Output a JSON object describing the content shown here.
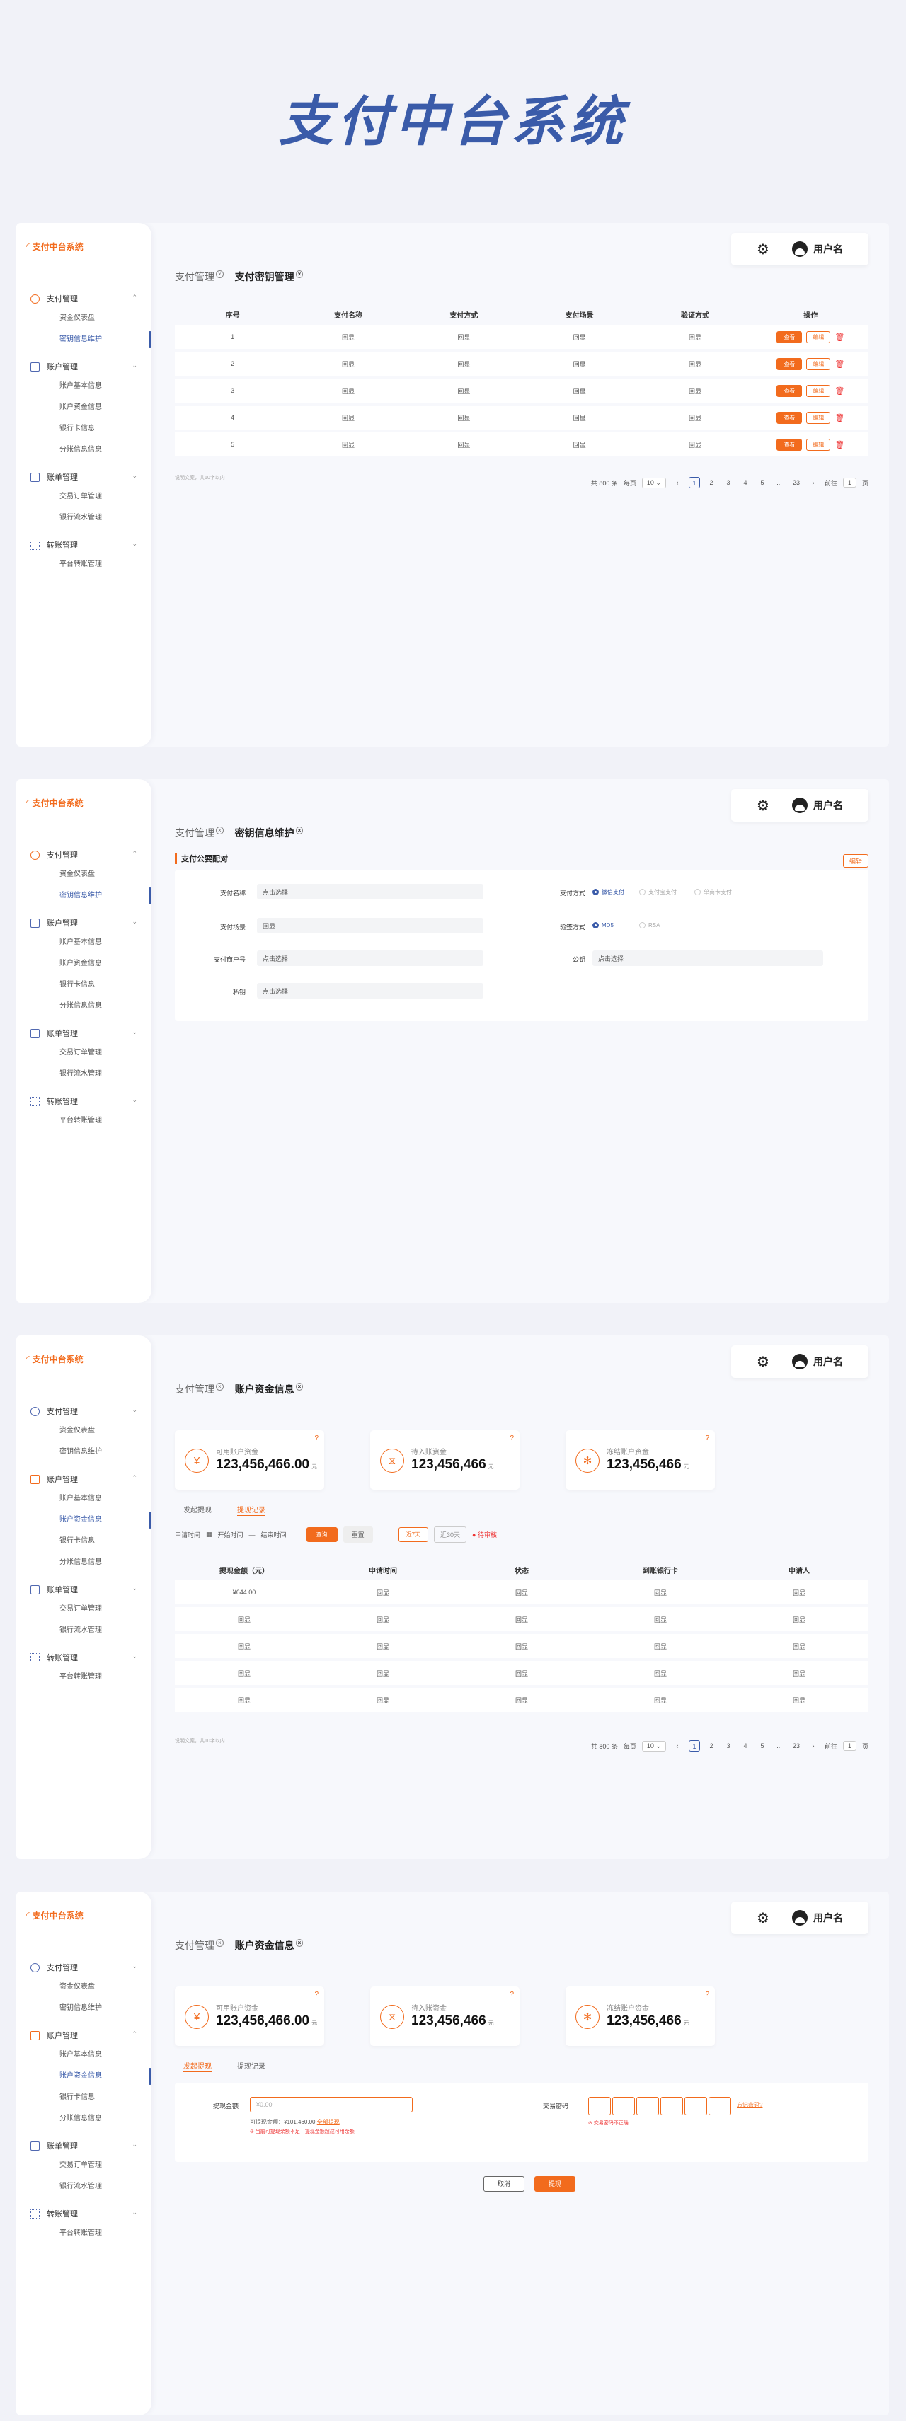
{
  "hero_title": "支付中台系统",
  "brand": "支付中台系统",
  "user_name": "用户名",
  "colors": {
    "accent": "#f26b1d",
    "primary": "#3a5ba9",
    "danger": "#e33333"
  },
  "menu": [
    {
      "label": "支付管理",
      "items": [
        "资金仪表盘",
        "密钥信息维护"
      ]
    },
    {
      "label": "账户管理",
      "items": [
        "账户基本信息",
        "账户资金信息",
        "银行卡信息",
        "分账信息信息"
      ]
    },
    {
      "label": "账单管理",
      "items": [
        "交易订单管理",
        "银行流水管理"
      ]
    },
    {
      "label": "转账管理",
      "items": [
        "平台转账管理"
      ]
    }
  ],
  "screen1": {
    "crumb1": "支付管理",
    "crumb2": "支付密钥管理",
    "headers": [
      "序号",
      "支付名称",
      "支付方式",
      "支付场景",
      "验证方式",
      "操作"
    ],
    "rows": [
      [
        "1",
        "回显",
        "回显",
        "回显",
        "回显"
      ],
      [
        "2",
        "回显",
        "回显",
        "回显",
        "回显"
      ],
      [
        "3",
        "回显",
        "回显",
        "回显",
        "回显"
      ],
      [
        "4",
        "回显",
        "回显",
        "回显",
        "回显"
      ],
      [
        "5",
        "回显",
        "回显",
        "回显",
        "回显"
      ]
    ],
    "op_view": "查看",
    "op_edit": "编辑",
    "note": "说明文案，共10字以内"
  },
  "pager": {
    "total": "共 800 条",
    "per": "每页",
    "size": "10",
    "pages": [
      "1",
      "2",
      "3",
      "4",
      "5",
      "...",
      "23"
    ],
    "goto": "前往",
    "goto_val": "1",
    "page_unit": "页"
  },
  "screen2": {
    "crumb1": "支付管理",
    "crumb2": "密钥信息维护",
    "section": "支付公要配对",
    "edit": "编辑",
    "fields_left": [
      {
        "label": "支付名称",
        "value": "点击选择"
      },
      {
        "label": "支付场景",
        "value": "回显"
      },
      {
        "label": "支付商户号",
        "value": "点击选择"
      },
      {
        "label": "私钥",
        "value": "点击选择"
      }
    ],
    "pay_label": "支付方式",
    "pay_opts": [
      "微信支付",
      "支付宝支付",
      "单商卡支付"
    ],
    "verify_label": "验签方式",
    "verify_opts": [
      "MD5",
      "RSA"
    ],
    "cert_label": "公钥",
    "cert_value": "点击选择"
  },
  "cards": [
    {
      "label": "可用账户资金",
      "value": "123,456,466.00",
      "unit": "元"
    },
    {
      "label": "待入账资金",
      "value": "123,456,466",
      "unit": "元"
    },
    {
      "label": "冻结账户资金",
      "value": "123,456,466",
      "unit": "元"
    }
  ],
  "screen3": {
    "crumb1": "支付管理",
    "crumb2": "账户资金信息",
    "tab1": "发起提现",
    "tab2": "提现记录",
    "filter_label": "申请时间",
    "start": "开始时间",
    "to": "—",
    "end": "结束时间",
    "query": "查询",
    "reset": "重置",
    "chip1": "近7天",
    "chip2": "近30天",
    "status": "待审核",
    "headers": [
      "提现金额（元）",
      "申请时间",
      "状态",
      "到账银行卡",
      "申请人"
    ],
    "rows": [
      [
        "¥644.00",
        "回显",
        "回显",
        "回显",
        "回显"
      ],
      [
        "回显",
        "回显",
        "回显",
        "回显",
        "回显"
      ],
      [
        "回显",
        "回显",
        "回显",
        "回显",
        "回显"
      ],
      [
        "回显",
        "回显",
        "回显",
        "回显",
        "回显"
      ],
      [
        "回显",
        "回显",
        "回显",
        "回显",
        "回显"
      ]
    ],
    "note": "说明文案，共10字以内"
  },
  "screen4": {
    "crumb1": "支付管理",
    "crumb2": "账户资金信息",
    "tab1": "发起提现",
    "tab2": "提现记录",
    "amount_label": "提现金额",
    "amount_placeholder": "¥0.00",
    "avail": "可提现金额：¥101,460.00",
    "all": "全部提现",
    "err": "当前可提现余额不足",
    "err2": "提现金额超过可用余额",
    "pwd_label": "交易密码",
    "forgot": "忘记密码?",
    "pwd_err": "交易密码不正确",
    "cancel": "取消",
    "submit": "提现"
  }
}
